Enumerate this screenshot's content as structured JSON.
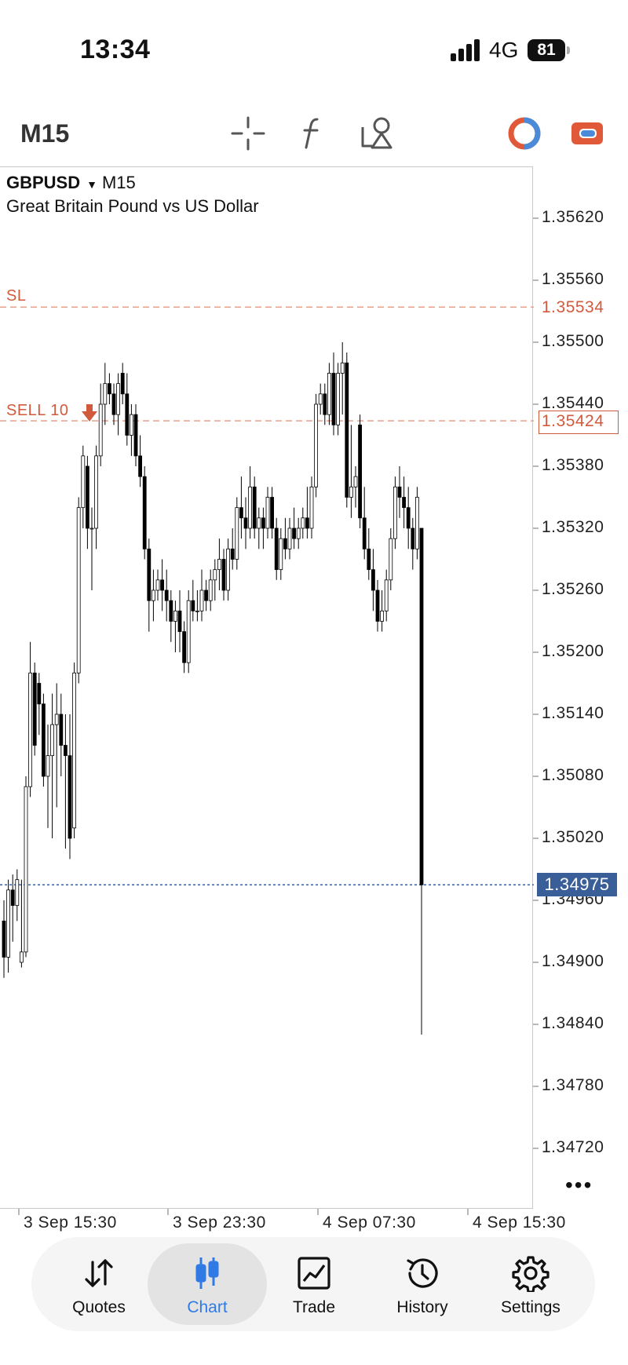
{
  "status_bar": {
    "time": "13:34",
    "network": "4G",
    "battery": "81"
  },
  "toolbar": {
    "timeframe": "M15",
    "tools": [
      "crosshair-icon",
      "indicators-f-icon",
      "objects-icon",
      "chart-color-icon",
      "trade-toggle-icon"
    ],
    "colors": {
      "accent_red": "#e05a3a",
      "accent_blue": "#4a8ad8"
    }
  },
  "chart": {
    "symbol": "GBPUSD",
    "timeframe": "M15",
    "description": "Great Britain Pound vs US Dollar",
    "sl_label": "SL",
    "sl_price": "1.35534",
    "sell_label": "SELL 10",
    "sell_price": "1.35424",
    "current_price": "1.34975",
    "more": "•••",
    "colors": {
      "up": "#ffffff",
      "down": "#000000",
      "sl": "#d25a3c",
      "current": "#3a5f98"
    }
  },
  "chart_data": {
    "type": "candlestick",
    "title": "",
    "y_ticks": [
      "1.35620",
      "1.35560",
      "1.35500",
      "1.35440",
      "1.35380",
      "1.35320",
      "1.35260",
      "1.35200",
      "1.35140",
      "1.35080",
      "1.35020",
      "1.34960",
      "1.34900",
      "1.34840",
      "1.34780",
      "1.34720"
    ],
    "x_ticks": [
      "3 Sep 15:30",
      "3 Sep 23:30",
      "4 Sep 07:30",
      "4 Sep 15:30"
    ],
    "ylim": [
      1.34675,
      1.35675
    ],
    "hlines": [
      {
        "label": "SL",
        "price": 1.35534
      },
      {
        "label": "SELL 10",
        "price": 1.35424
      },
      {
        "label": "current",
        "price": 1.34975
      }
    ],
    "candles": [
      [
        1.3494,
        1.3496,
        1.34885,
        1.34905
      ],
      [
        1.34905,
        1.3498,
        1.3489,
        1.3497
      ],
      [
        1.3497,
        1.34985,
        1.3492,
        1.34955
      ],
      [
        1.34955,
        1.3499,
        1.3494,
        1.3498
      ],
      [
        1.349,
        1.3498,
        1.34895,
        1.3491
      ],
      [
        1.3491,
        1.3508,
        1.34905,
        1.3507
      ],
      [
        1.3507,
        1.3521,
        1.3506,
        1.3518
      ],
      [
        1.3518,
        1.3519,
        1.351,
        1.3511
      ],
      [
        1.3517,
        1.3518,
        1.3512,
        1.3515
      ],
      [
        1.3515,
        1.3516,
        1.3507,
        1.3508
      ],
      [
        1.3508,
        1.3513,
        1.3503,
        1.351
      ],
      [
        1.351,
        1.3516,
        1.3502,
        1.3513
      ],
      [
        1.3513,
        1.3517,
        1.3505,
        1.3514
      ],
      [
        1.3514,
        1.3516,
        1.3508,
        1.3511
      ],
      [
        1.3511,
        1.3514,
        1.3501,
        1.351
      ],
      [
        1.351,
        1.3514,
        1.35,
        1.3502
      ],
      [
        1.3503,
        1.3519,
        1.3502,
        1.3518
      ],
      [
        1.3518,
        1.3535,
        1.3517,
        1.3534
      ],
      [
        1.3534,
        1.354,
        1.3532,
        1.3539
      ],
      [
        1.3538,
        1.3539,
        1.353,
        1.3532
      ],
      [
        1.3532,
        1.3534,
        1.3526,
        1.3532
      ],
      [
        1.3532,
        1.354,
        1.353,
        1.3539
      ],
      [
        1.3539,
        1.3546,
        1.3538,
        1.3544
      ],
      [
        1.3544,
        1.3548,
        1.3542,
        1.3546
      ],
      [
        1.3546,
        1.3547,
        1.3544,
        1.3545
      ],
      [
        1.3545,
        1.3546,
        1.3542,
        1.3543
      ],
      [
        1.3543,
        1.3547,
        1.3541,
        1.3546
      ],
      [
        1.3547,
        1.3548,
        1.3544,
        1.3545
      ],
      [
        1.3545,
        1.3547,
        1.354,
        1.3541
      ],
      [
        1.3541,
        1.3544,
        1.3539,
        1.3543
      ],
      [
        1.3543,
        1.3544,
        1.3538,
        1.3539
      ],
      [
        1.3539,
        1.3541,
        1.3536,
        1.3537
      ],
      [
        1.3537,
        1.3538,
        1.3529,
        1.353
      ],
      [
        1.353,
        1.3531,
        1.3522,
        1.3525
      ],
      [
        1.3525,
        1.3528,
        1.3523,
        1.3526
      ],
      [
        1.3526,
        1.3528,
        1.3525,
        1.3527
      ],
      [
        1.3527,
        1.3529,
        1.3524,
        1.3526
      ],
      [
        1.3526,
        1.3528,
        1.3523,
        1.3525
      ],
      [
        1.3525,
        1.3526,
        1.3521,
        1.3523
      ],
      [
        1.3523,
        1.3525,
        1.352,
        1.3524
      ],
      [
        1.3524,
        1.3526,
        1.352,
        1.3522
      ],
      [
        1.3522,
        1.3523,
        1.3518,
        1.3519
      ],
      [
        1.3519,
        1.3526,
        1.3518,
        1.3525
      ],
      [
        1.3525,
        1.3527,
        1.3523,
        1.3524
      ],
      [
        1.3524,
        1.3526,
        1.3523,
        1.3524
      ],
      [
        1.3524,
        1.3528,
        1.3523,
        1.3526
      ],
      [
        1.3526,
        1.3527,
        1.3524,
        1.3525
      ],
      [
        1.3525,
        1.3528,
        1.3524,
        1.3527
      ],
      [
        1.3527,
        1.3529,
        1.3525,
        1.3528
      ],
      [
        1.3528,
        1.3531,
        1.3526,
        1.3529
      ],
      [
        1.3529,
        1.353,
        1.3525,
        1.3526
      ],
      [
        1.3526,
        1.3531,
        1.3525,
        1.353
      ],
      [
        1.353,
        1.3532,
        1.3528,
        1.3529
      ],
      [
        1.3529,
        1.3535,
        1.3528,
        1.3534
      ],
      [
        1.3534,
        1.3537,
        1.3531,
        1.3533
      ],
      [
        1.3533,
        1.3535,
        1.353,
        1.3532
      ],
      [
        1.3532,
        1.3538,
        1.3531,
        1.3536
      ],
      [
        1.3536,
        1.3537,
        1.3531,
        1.3532
      ],
      [
        1.3532,
        1.3534,
        1.353,
        1.3533
      ],
      [
        1.3533,
        1.3534,
        1.353,
        1.3532
      ],
      [
        1.3532,
        1.3536,
        1.3531,
        1.3535
      ],
      [
        1.3535,
        1.3536,
        1.3531,
        1.3532
      ],
      [
        1.3532,
        1.3533,
        1.3527,
        1.3528
      ],
      [
        1.3528,
        1.3532,
        1.3527,
        1.3531
      ],
      [
        1.3531,
        1.3533,
        1.3529,
        1.353
      ],
      [
        1.353,
        1.3533,
        1.3529,
        1.3532
      ],
      [
        1.3532,
        1.3534,
        1.353,
        1.3531
      ],
      [
        1.3531,
        1.3533,
        1.353,
        1.3532
      ],
      [
        1.3532,
        1.3534,
        1.3531,
        1.3533
      ],
      [
        1.3533,
        1.3536,
        1.3531,
        1.3532
      ],
      [
        1.3532,
        1.3537,
        1.3531,
        1.3536
      ],
      [
        1.3536,
        1.3545,
        1.3535,
        1.3544
      ],
      [
        1.3544,
        1.3546,
        1.3543,
        1.3545
      ],
      [
        1.3545,
        1.3546,
        1.3542,
        1.3543
      ],
      [
        1.3543,
        1.3548,
        1.3542,
        1.3547
      ],
      [
        1.3547,
        1.3549,
        1.3541,
        1.3542
      ],
      [
        1.3542,
        1.3548,
        1.3541,
        1.3547
      ],
      [
        1.3547,
        1.355,
        1.3543,
        1.3548
      ],
      [
        1.3548,
        1.3549,
        1.3534,
        1.3535
      ],
      [
        1.3535,
        1.3542,
        1.3533,
        1.3536
      ],
      [
        1.3536,
        1.3538,
        1.3534,
        1.3537
      ],
      [
        1.3542,
        1.3543,
        1.3532,
        1.3533
      ],
      [
        1.3533,
        1.3536,
        1.3529,
        1.353
      ],
      [
        1.353,
        1.3532,
        1.3527,
        1.3528
      ],
      [
        1.3528,
        1.353,
        1.3524,
        1.3526
      ],
      [
        1.3526,
        1.3527,
        1.3522,
        1.3523
      ],
      [
        1.3523,
        1.3526,
        1.3522,
        1.3524
      ],
      [
        1.3524,
        1.3528,
        1.3523,
        1.3527
      ],
      [
        1.3527,
        1.3532,
        1.3526,
        1.3531
      ],
      [
        1.3531,
        1.3537,
        1.353,
        1.3536
      ],
      [
        1.3536,
        1.3538,
        1.3533,
        1.3535
      ],
      [
        1.3535,
        1.3537,
        1.3532,
        1.3534
      ],
      [
        1.3534,
        1.3536,
        1.353,
        1.3532
      ],
      [
        1.3532,
        1.3533,
        1.3528,
        1.353
      ],
      [
        1.353,
        1.3536,
        1.3529,
        1.3535
      ],
      [
        1.3532,
        1.3532,
        1.3483,
        1.34975
      ]
    ]
  },
  "tabs": [
    {
      "label": "Quotes",
      "icon": "quotes-arrows-icon"
    },
    {
      "label": "Chart",
      "icon": "chart-candles-icon",
      "active": true
    },
    {
      "label": "Trade",
      "icon": "trade-chart-icon"
    },
    {
      "label": "History",
      "icon": "history-clock-icon"
    },
    {
      "label": "Settings",
      "icon": "settings-gear-icon"
    }
  ]
}
